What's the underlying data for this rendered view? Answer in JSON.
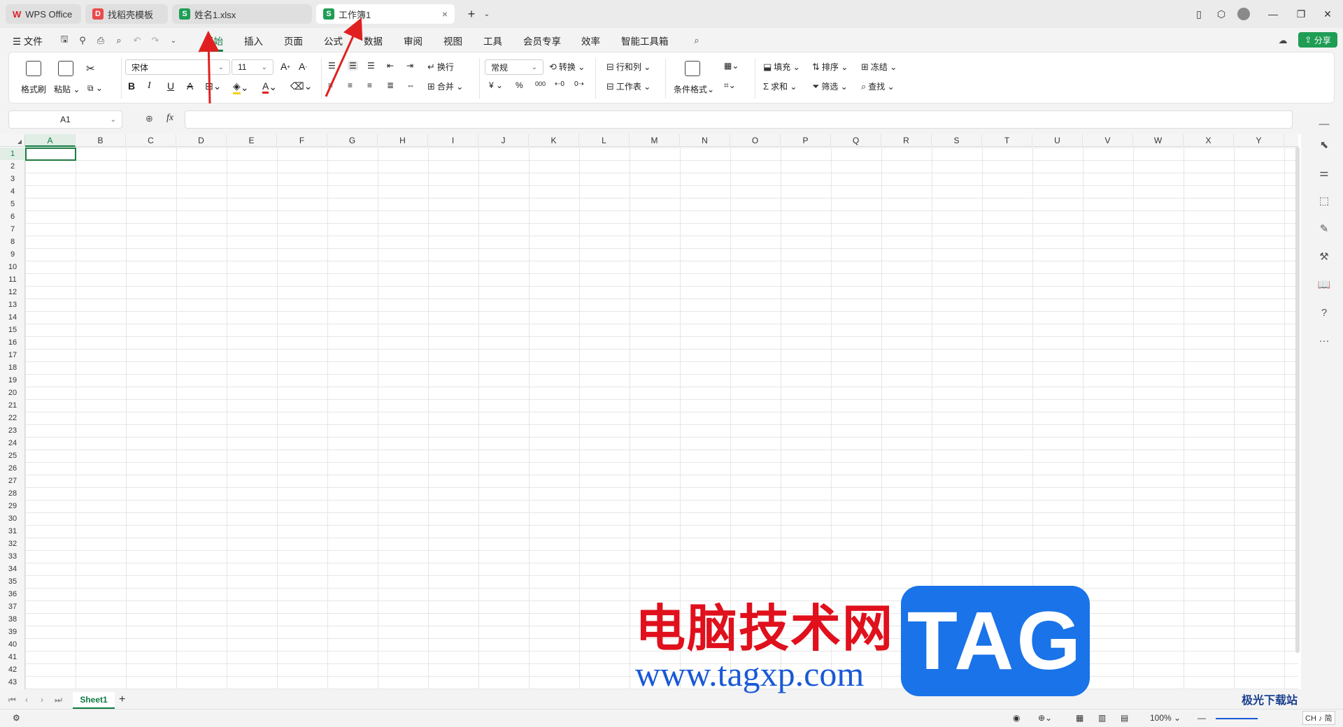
{
  "tabs": [
    {
      "label": "WPS Office",
      "icon": "wps-logo-icon",
      "color": "#d8242b"
    },
    {
      "label": "找稻壳模板",
      "icon": "docer-icon",
      "color": "#e94a4a"
    },
    {
      "label": "姓名1.xlsx",
      "icon": "S",
      "color": "#1f9d55"
    },
    {
      "label": "工作簿1",
      "icon": "S",
      "color": "#1f9d55",
      "active": true
    }
  ],
  "menu": {
    "file": "文件",
    "items": [
      "开始",
      "插入",
      "页面",
      "公式",
      "数据",
      "审阅",
      "视图",
      "工具",
      "会员专享",
      "效率",
      "智能工具箱"
    ],
    "share": "分享"
  },
  "ribbon": {
    "format_painter": "格式刷",
    "paste": "粘贴",
    "font_name": "宋体",
    "font_size": "11",
    "wrap": "换行",
    "merge": "合并",
    "number_format": "常规",
    "convert": "转换",
    "row_col": "行和列",
    "worksheet": "工作表",
    "cond_format": "条件格式",
    "fill": "填充",
    "sort": "排序",
    "freeze": "冻结",
    "sum": "求和",
    "filter": "筛选",
    "find": "查找",
    "bold": "B",
    "italic": "I",
    "underline": "U",
    "strike": "A",
    "currency": "¥",
    "percent": "%",
    "thousands": "000"
  },
  "formula": {
    "name_box": "A1",
    "fx": "fx",
    "value": ""
  },
  "columns": [
    "A",
    "B",
    "C",
    "D",
    "E",
    "F",
    "G",
    "H",
    "I",
    "J",
    "K",
    "L",
    "M",
    "N",
    "O",
    "P",
    "Q",
    "R",
    "S",
    "T",
    "U",
    "V",
    "W",
    "X",
    "Y"
  ],
  "rows": [
    "1",
    "2",
    "3",
    "4",
    "5",
    "6",
    "7",
    "8",
    "9",
    "10",
    "11",
    "12",
    "13",
    "14",
    "15",
    "16",
    "17",
    "18",
    "19",
    "20",
    "21",
    "22",
    "23",
    "24",
    "25",
    "26",
    "27",
    "28",
    "29",
    "30",
    "31",
    "32",
    "33",
    "34",
    "35",
    "36",
    "37",
    "38",
    "39",
    "40",
    "41",
    "42",
    "43"
  ],
  "sheet": {
    "name": "Sheet1",
    "add": "+"
  },
  "status": {
    "zoom": "100%",
    "ime": "CH ♪ 简"
  },
  "watermark": {
    "cn": "电脑技术网",
    "url": "www.tagxp.com",
    "tag": "TAG",
    "site": "极光下载站"
  },
  "colors": {
    "accent": "#0e7a43",
    "arrow": "#e02020"
  }
}
